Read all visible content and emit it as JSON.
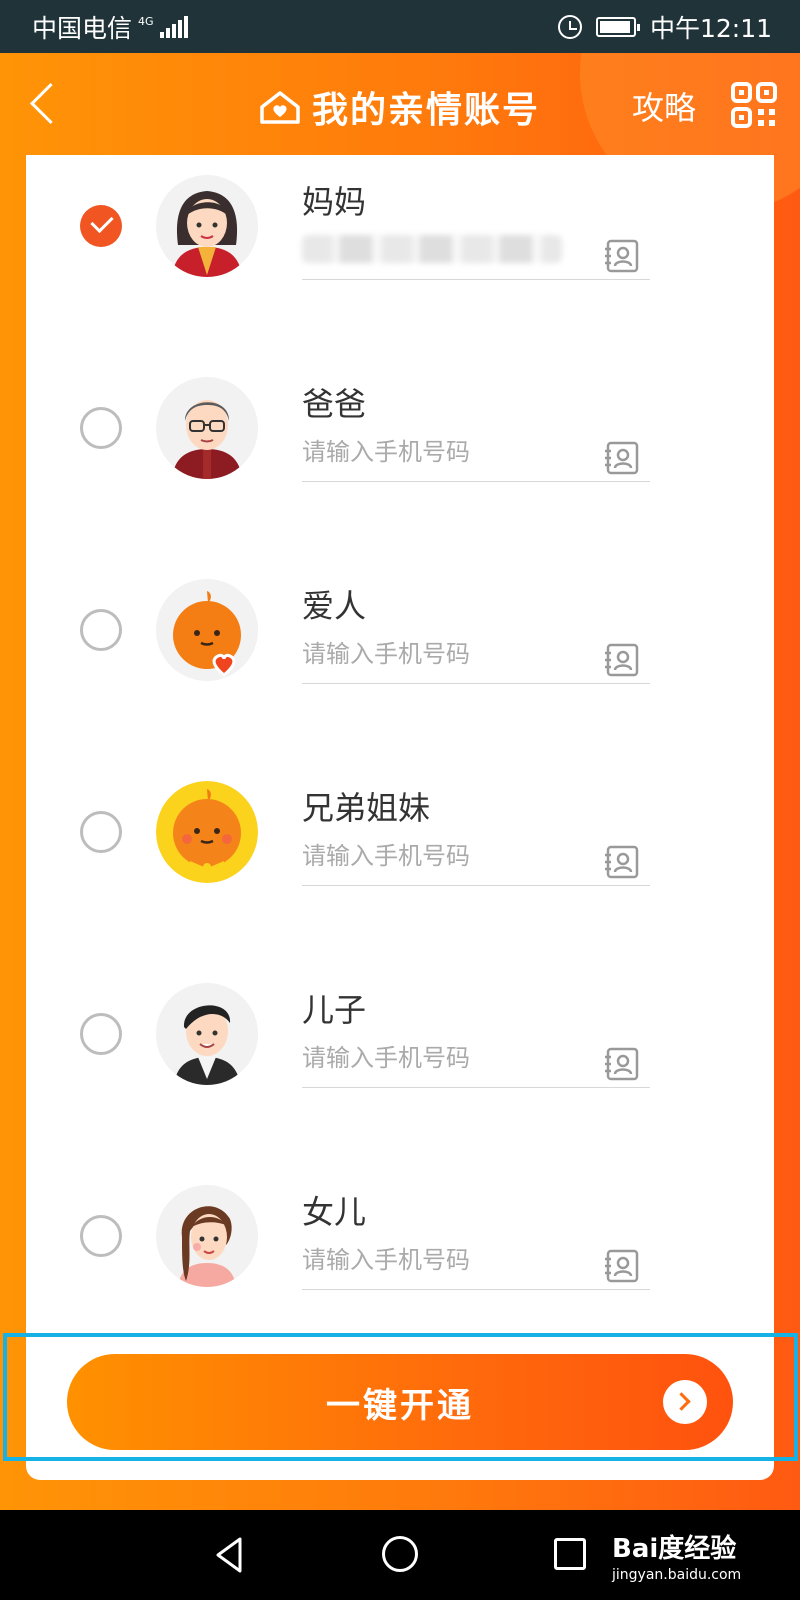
{
  "status_bar": {
    "carrier": "中国电信",
    "network": "4G",
    "time": "中午12:11"
  },
  "header": {
    "title": "我的亲情账号",
    "strategy_label": "攻略",
    "icons": {
      "back": "chevron-left-icon",
      "home": "home-heart-icon",
      "qr": "qr-code-icon"
    }
  },
  "family": {
    "members": [
      {
        "label": "妈妈",
        "placeholder": "",
        "selected": true,
        "value_blurred": true
      },
      {
        "label": "爸爸",
        "placeholder": "请输入手机号码",
        "selected": false
      },
      {
        "label": "爱人",
        "placeholder": "请输入手机号码",
        "selected": false
      },
      {
        "label": "兄弟姐妹",
        "placeholder": "请输入手机号码",
        "selected": false
      },
      {
        "label": "儿子",
        "placeholder": "请输入手机号码",
        "selected": false
      },
      {
        "label": "女儿",
        "placeholder": "请输入手机号码",
        "selected": false
      }
    ]
  },
  "action": {
    "open_label": "一键开通"
  },
  "watermark": {
    "brand": "Bai度经验",
    "url": "jingyan.baidu.com"
  },
  "colors": {
    "accent": "#ff7a0c",
    "check": "#f05522",
    "highlight": "#16b2e6"
  }
}
